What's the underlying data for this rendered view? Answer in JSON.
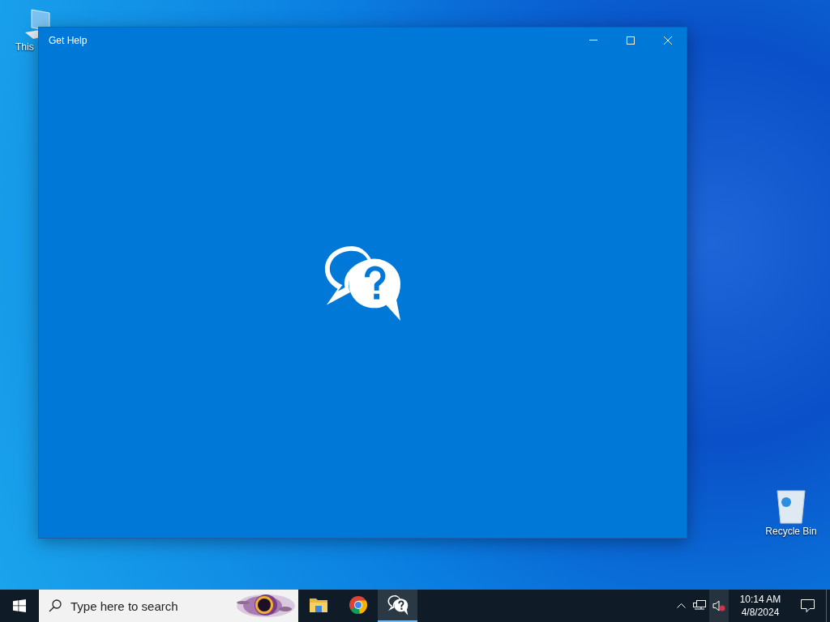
{
  "desktop_icons": [
    {
      "kind": "computer",
      "label": "This"
    },
    {
      "kind": "recycle",
      "label": "Recycle Bin"
    }
  ],
  "window": {
    "title": "Get Help"
  },
  "taskbar": {
    "search": {
      "placeholder": "Type here to search"
    },
    "apps": [
      {
        "kind": "explorer",
        "selected": false
      },
      {
        "kind": "chrome",
        "selected": false
      },
      {
        "kind": "help",
        "selected": true
      }
    ],
    "clock": {
      "time": "10:14 AM",
      "date": "4/8/2024"
    }
  }
}
